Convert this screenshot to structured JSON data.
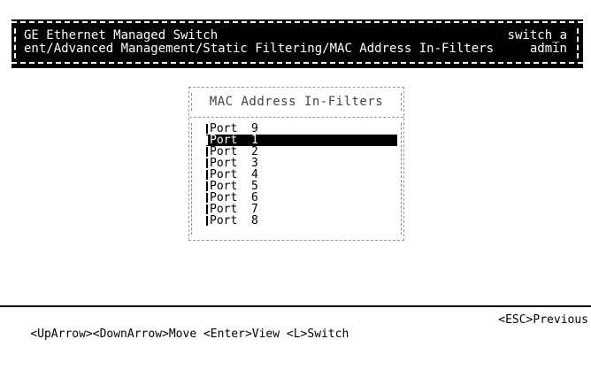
{
  "header": {
    "title": "GE Ethernet Managed Switch",
    "breadcrumb": "ent/Advanced Management/Static Filtering/MAC Address In-Filters",
    "hostname": "switch_a",
    "user": "admin"
  },
  "dialog": {
    "title": "MAC Address In-Filters",
    "items": [
      {
        "label": "Port  9",
        "selected": false
      },
      {
        "label": "Port  1",
        "selected": true
      },
      {
        "label": "Port  2",
        "selected": false
      },
      {
        "label": "Port  3",
        "selected": false
      },
      {
        "label": "Port  4",
        "selected": false
      },
      {
        "label": "Port  5",
        "selected": false
      },
      {
        "label": "Port  6",
        "selected": false
      },
      {
        "label": "Port  7",
        "selected": false
      },
      {
        "label": "Port  8",
        "selected": false
      }
    ]
  },
  "footer": {
    "help": "<UpArrow><DownArrow>Move <Enter>View <L>Switch",
    "escape": "<ESC>Previous"
  }
}
